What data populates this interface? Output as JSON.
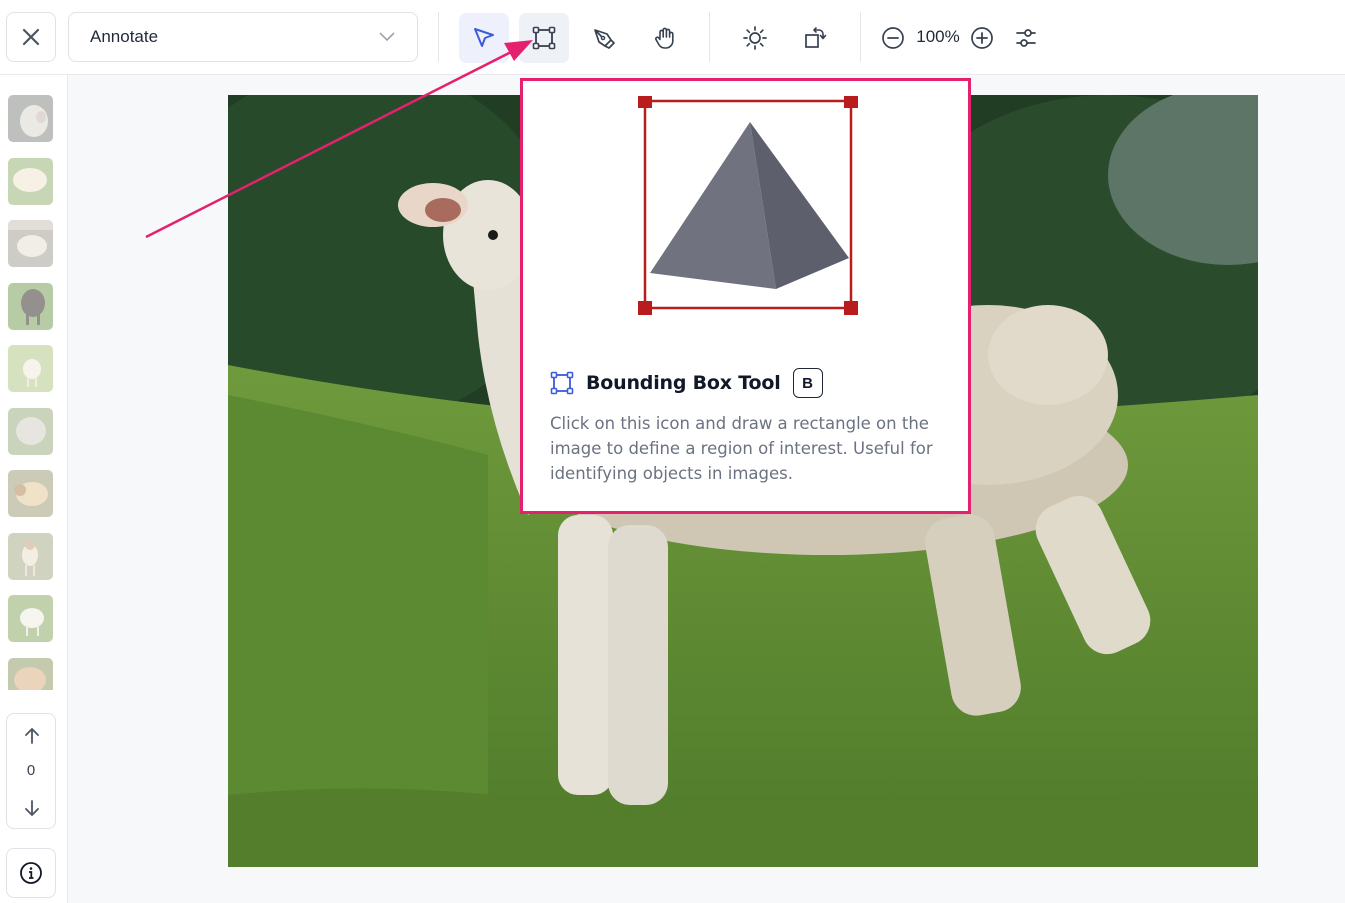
{
  "toolbar": {
    "mode_label": "Annotate",
    "zoom_level": "100%",
    "tools": [
      {
        "name": "select-tool",
        "icon": "cursor-arrow-icon",
        "active": true
      },
      {
        "name": "bounding-box-tool",
        "icon": "bounding-box-icon",
        "highlighted": true
      },
      {
        "name": "polygon-pen-tool",
        "icon": "pen-nib-icon"
      },
      {
        "name": "pan-tool",
        "icon": "hand-icon"
      },
      {
        "name": "brightness-tool",
        "icon": "sun-icon"
      },
      {
        "name": "rotate-tool",
        "icon": "rotate-icon"
      },
      {
        "name": "zoom-out-button",
        "icon": "minus-circle-icon"
      },
      {
        "name": "zoom-in-button",
        "icon": "plus-circle-icon"
      },
      {
        "name": "settings-button",
        "icon": "sliders-icon"
      }
    ]
  },
  "sidebar": {
    "image_count": "0",
    "thumbnails": [
      "sheep-1",
      "sheep-2",
      "sheep-3",
      "sheep-4",
      "sheep-5",
      "sheep-6",
      "sheep-7",
      "sheep-8",
      "sheep-9",
      "sheep-10"
    ]
  },
  "tooltip": {
    "title": "Bounding Box Tool",
    "shortcut_key": "B",
    "description": "Click on this icon and draw a rectangle on the image to define a region of interest. Useful for identifying objects in images."
  },
  "colors": {
    "accent": "#3b5bdb",
    "highlight_border": "#e5216f",
    "bbox_red": "#b91c1c",
    "pyramid": "#6b6e7e"
  }
}
